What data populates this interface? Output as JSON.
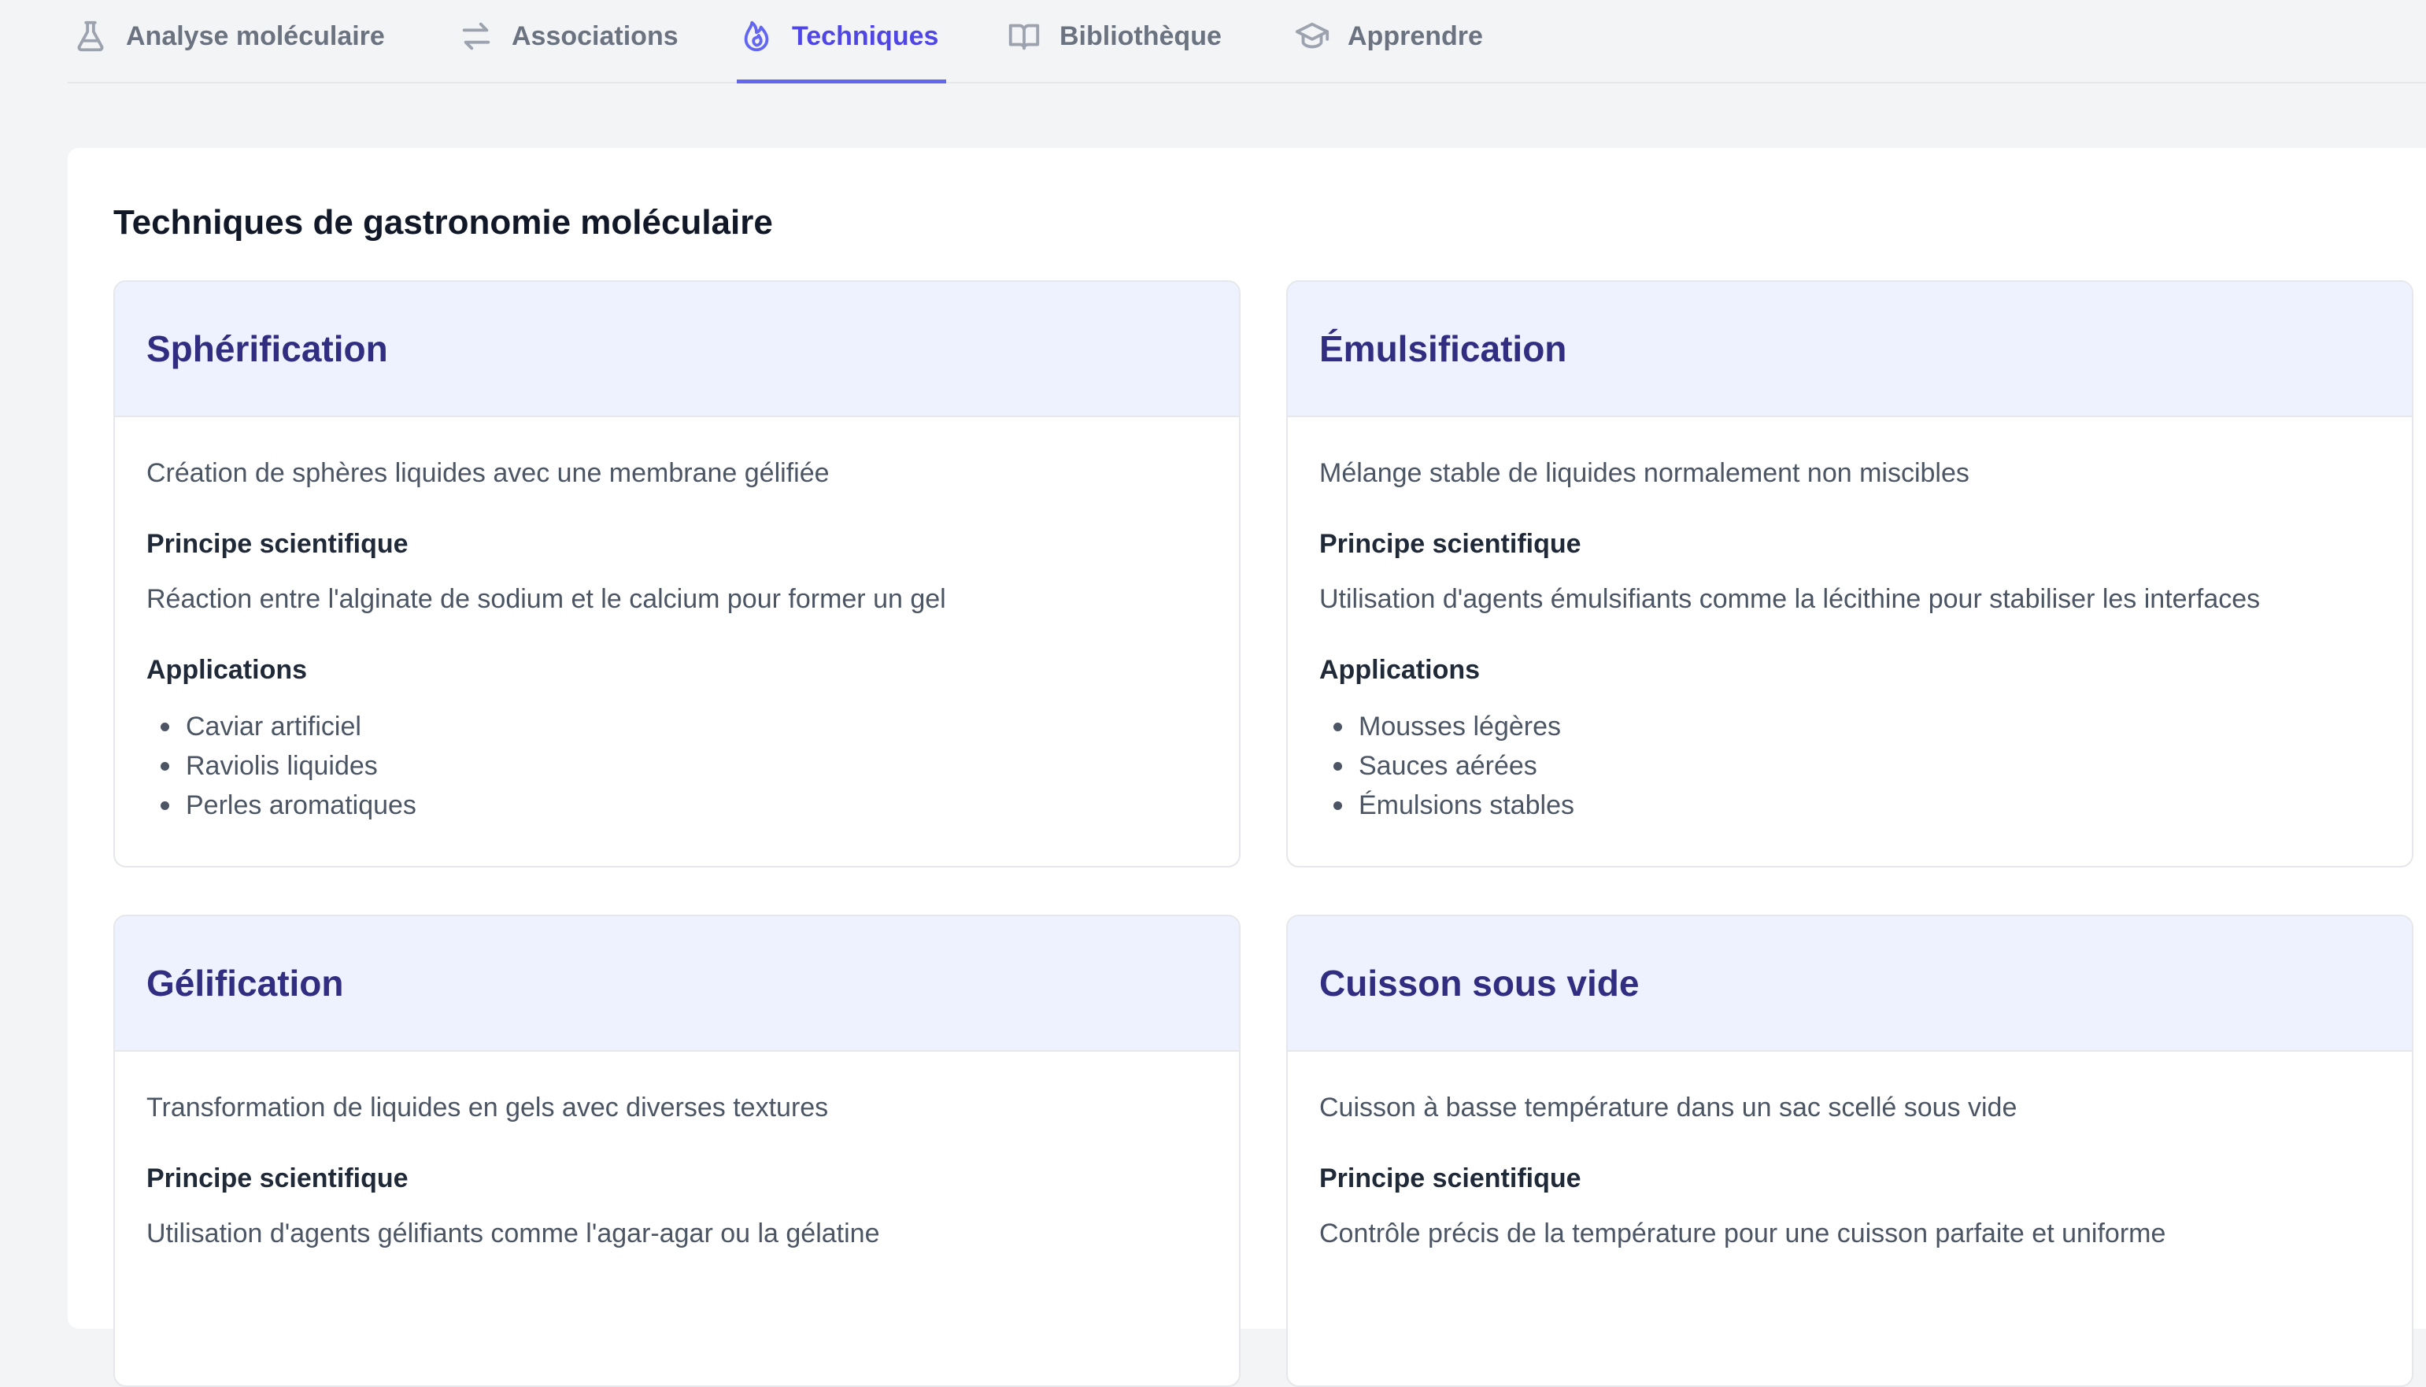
{
  "tabs": [
    {
      "label": "Analyse moléculaire",
      "icon": "flask-icon",
      "active": false
    },
    {
      "label": "Associations",
      "icon": "arrows-swap-icon",
      "active": false
    },
    {
      "label": "Techniques",
      "icon": "fire-icon",
      "active": true
    },
    {
      "label": "Bibliothèque",
      "icon": "book-icon",
      "active": false
    },
    {
      "label": "Apprendre",
      "icon": "graduation-cap-icon",
      "active": false
    }
  ],
  "main": {
    "title": "Techniques de gastronomie moléculaire",
    "principle_heading": "Principe scientifique",
    "applications_heading": "Applications"
  },
  "techniques": [
    {
      "name": "Sphérification",
      "description": "Création de sphères liquides avec une membrane gélifiée",
      "principle": "Réaction entre l'alginate de sodium et le calcium pour former un gel",
      "applications": [
        "Caviar artificiel",
        "Raviolis liquides",
        "Perles aromatiques"
      ]
    },
    {
      "name": "Émulsification",
      "description": "Mélange stable de liquides normalement non miscibles",
      "principle": "Utilisation d'agents émulsifiants comme la lécithine pour stabiliser les interfaces",
      "applications": [
        "Mousses légères",
        "Sauces aérées",
        "Émulsions stables"
      ]
    },
    {
      "name": "Gélification",
      "description": "Transformation de liquides en gels avec diverses textures",
      "principle": "Utilisation d'agents gélifiants comme l'agar-agar ou la gélatine",
      "applications": []
    },
    {
      "name": "Cuisson sous vide",
      "description": "Cuisson à basse température dans un sac scellé sous vide",
      "principle": "Contrôle précis de la température pour une cuisson parfaite et uniforme",
      "applications": []
    }
  ],
  "colors": {
    "accent": "#6366f1",
    "card_header": "#eef2ff",
    "card_title": "#312e81"
  }
}
